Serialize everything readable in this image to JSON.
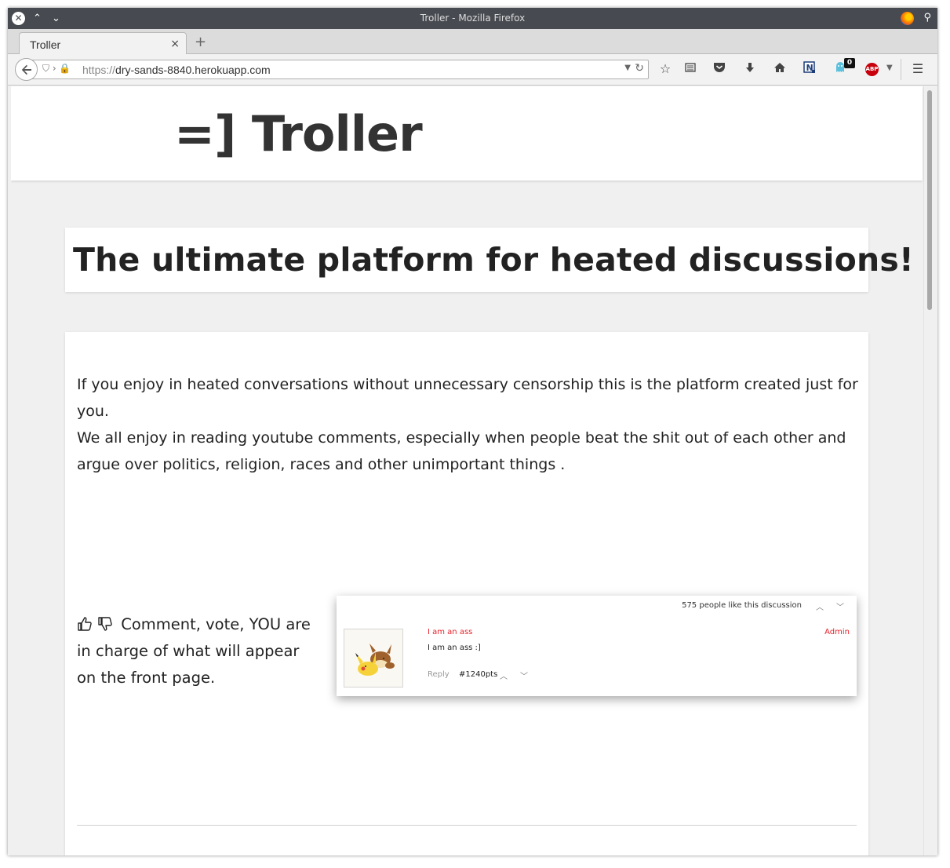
{
  "window": {
    "title": "Troller - Mozilla Firefox"
  },
  "tab": {
    "label": "Troller",
    "close": "×",
    "new": "+"
  },
  "nav": {
    "url_protocol": "https://",
    "url_host": "dry-sands-8840.herokuapp.com",
    "ghost_badge": "0",
    "abp_label": "ABP"
  },
  "site": {
    "logo": "=] Troller",
    "hero_title": "The ultimate platform for heated discussions!",
    "intro_1": "If you enjoy in heated conversations without unnecessary censorship this is the platform created just for you.",
    "intro_2": "We all enjoy in reading youtube comments, especially when people beat the shit out of each other and argue over politics, religion, races and other unimportant things .",
    "feature_text": "Comment, vote, YOU are in charge of what will appear on the front page."
  },
  "comment_preview": {
    "likes": "575 people like this discussion",
    "author": "I am an ass",
    "role": "Admin",
    "text": "I am an ass :]",
    "reply": "Reply",
    "points": "#1240pts"
  },
  "colors": {
    "accent": "#e8242c",
    "title_bar": "#474a50",
    "page_bg": "#f0f0f0"
  }
}
